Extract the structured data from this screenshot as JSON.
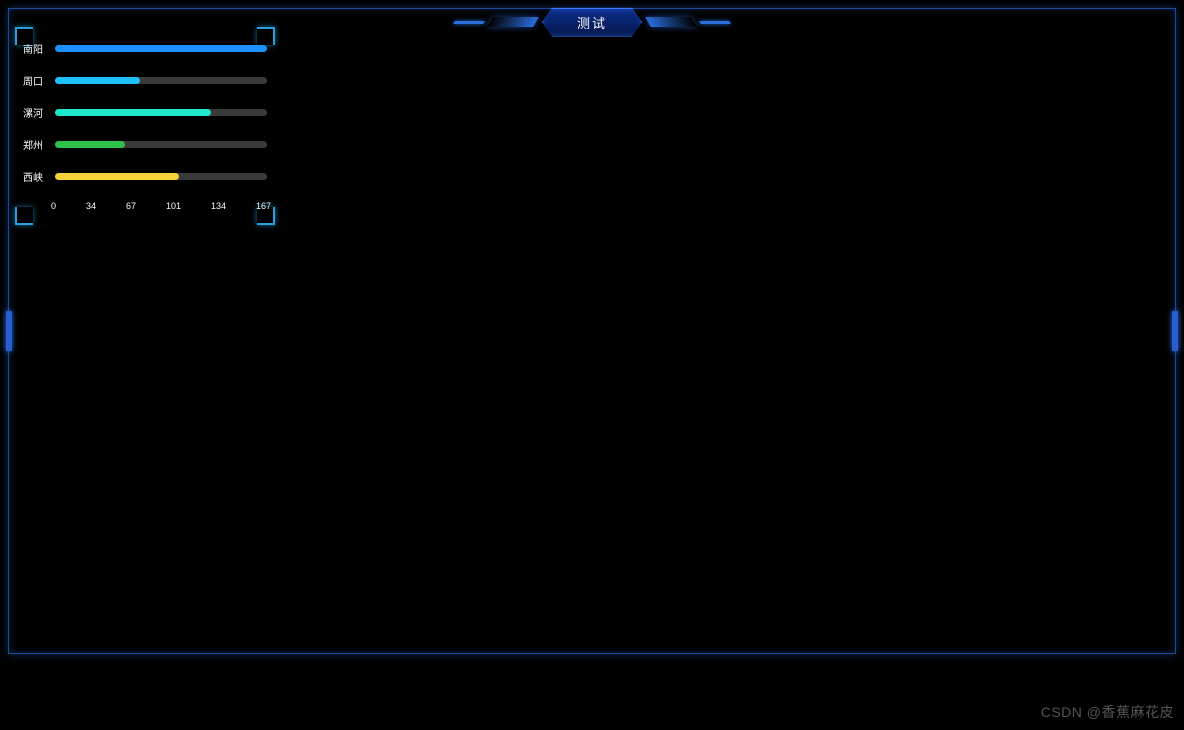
{
  "header": {
    "title": "测试"
  },
  "watermark": "CSDN @香蕉麻花皮",
  "chart_data": {
    "type": "bar",
    "orientation": "horizontal",
    "xlabel": "",
    "ylabel": "",
    "xlim": [
      0,
      167
    ],
    "x_ticks": [
      0,
      34,
      67,
      101,
      134,
      167
    ],
    "categories": [
      "南阳",
      "周口",
      "漯河",
      "郑州",
      "西峡"
    ],
    "values": [
      167,
      67,
      123,
      55,
      98
    ],
    "bar_colors": [
      "#1e90ff",
      "#1ec0ff",
      "#1ee6c8",
      "#2ec24a",
      "#f5d23c"
    ],
    "track_color": "#3a3a3a"
  }
}
